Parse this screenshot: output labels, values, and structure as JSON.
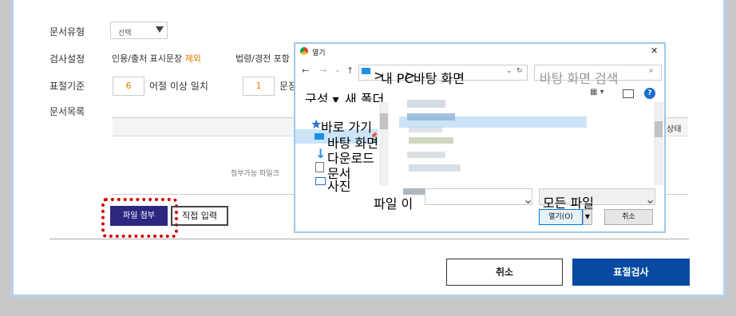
{
  "form": {
    "doc_type_label": "문서유형",
    "doc_type_select": "선택",
    "check_settings_label": "검사설정",
    "citation_text": "인용/출처 표시문장 ",
    "citation_excluded": "제외",
    "law_text": "법령/경전 포함",
    "threshold_label": "표절기준",
    "word_count": "6",
    "word_match_text": "어절 이상 일치",
    "sentence_count": "1",
    "sentence_text": "문장",
    "doc_list_label": "문서목록",
    "status_col": "상태",
    "attach_hint": "첨부가능 파일크",
    "attach_button": "파일 첨부",
    "direct_input_button": "직접 입력",
    "cancel_button": "취소",
    "check_button": "표절검사"
  },
  "dialog": {
    "title": "열기",
    "close": "✕",
    "breadcrumb_pc": "내 PC",
    "breadcrumb_sep": ">",
    "breadcrumb_desktop": "바탕 화면",
    "search_placeholder": "바탕 화면 검색",
    "organize": "구성 ▾",
    "new_folder": "새 폴더",
    "nav_items": [
      {
        "label": "바로 가기",
        "icon": "star-icon"
      },
      {
        "label": "바탕 화면",
        "icon": "desktop-icon"
      },
      {
        "label": "다운로드",
        "icon": "download-icon"
      },
      {
        "label": "문서",
        "icon": "document-icon"
      },
      {
        "label": "사진",
        "icon": "picture-icon"
      }
    ],
    "filename_label": "파일 이",
    "filetype": "모든 파일",
    "open_button": "열기(O)",
    "cancel_button": "취소"
  }
}
